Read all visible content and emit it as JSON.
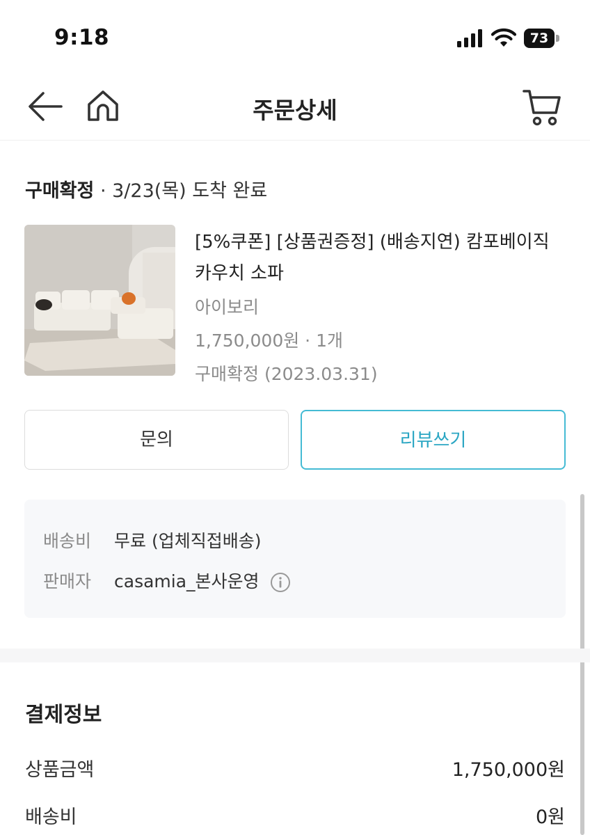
{
  "status_bar": {
    "time": "9:18",
    "battery": "73",
    "icons": [
      "signal-icon",
      "wifi-icon",
      "battery-icon"
    ]
  },
  "nav": {
    "title": "주문상세",
    "icons": [
      "back-arrow-icon",
      "home-icon",
      "cart-icon"
    ]
  },
  "order": {
    "status_label": "구매확정",
    "status_detail": " · 3/23(목) 도착 완료",
    "product": {
      "name": "[5%쿠폰] [상품권증정] (배송지연) 캄포베이직 카우치 소파",
      "option": "아이보리",
      "price_qty": "1,750,000원 · 1개",
      "confirm": "구매확정 (2023.03.31)"
    },
    "buttons": {
      "inquiry": "문의",
      "review": "리뷰쓰기"
    },
    "delivery": {
      "fee_label": "배송비",
      "fee_value": "무료 (업체직접배송)",
      "seller_label": "판매자",
      "seller_value": "casamia_본사운영"
    }
  },
  "payment": {
    "title": "결제정보",
    "rows": [
      {
        "label": "상품금액",
        "value": "1,750,000원"
      },
      {
        "label": "배송비",
        "value": "0원"
      }
    ]
  },
  "colors": {
    "accent": "#44bbd4",
    "accent_text": "#2aa6c3",
    "muted_text": "#8b8b8b",
    "box_bg": "#f7f8fa"
  }
}
